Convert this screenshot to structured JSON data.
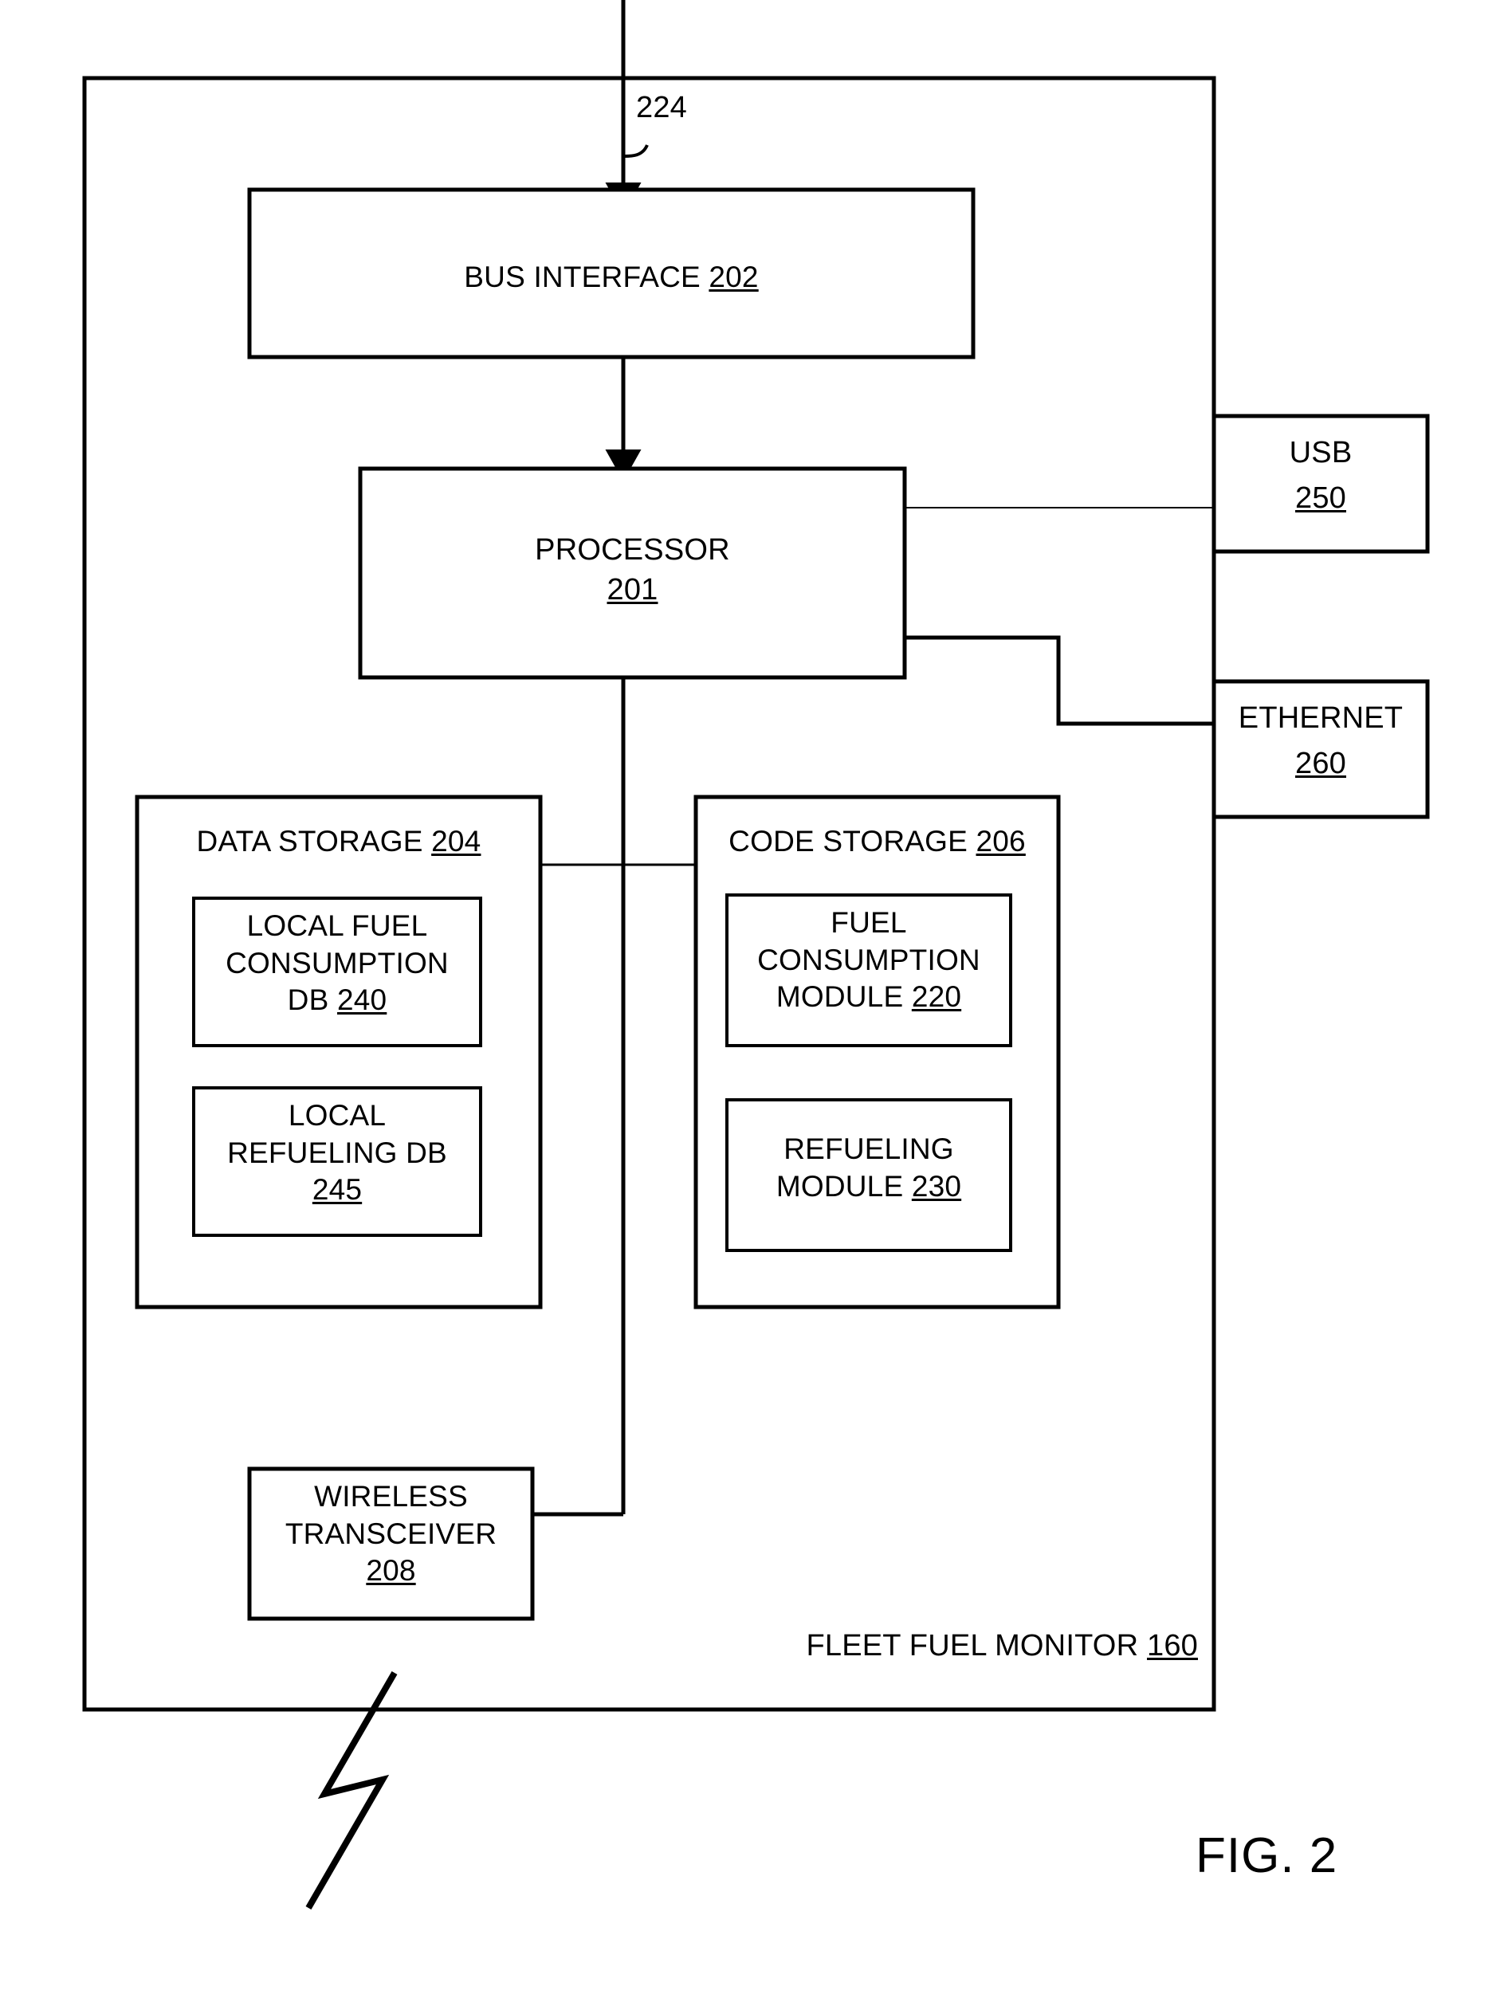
{
  "figure": {
    "caption": "FIG. 2",
    "outer_enclosure": {
      "name": "FLEET FUEL MONITOR",
      "ref": "160",
      "footer_text": "FLEET FUEL MONITOR 160"
    },
    "input_arrow_ref": "224"
  },
  "blocks": {
    "bus_interface": {
      "title": "BUS INTERFACE",
      "ref": "202"
    },
    "processor": {
      "title": "PROCESSOR",
      "ref": "201"
    },
    "data_storage": {
      "title": "DATA STORAGE",
      "ref": "204"
    },
    "code_storage": {
      "title": "CODE STORAGE",
      "ref": "206"
    },
    "local_fuel_consumption_db": {
      "line1": "LOCAL FUEL",
      "line2": "CONSUMPTION",
      "line3": "DB",
      "ref": "240"
    },
    "local_refueling_db": {
      "line1": "LOCAL",
      "line2": "REFUELING DB",
      "ref": "245"
    },
    "fuel_consumption_module": {
      "line1": "FUEL",
      "line2": "CONSUMPTION",
      "line3": "MODULE",
      "ref": "220"
    },
    "refueling_module": {
      "line1": "REFUELING",
      "line2": "MODULE",
      "ref": "230"
    },
    "wireless_transceiver": {
      "line1": "WIRELESS",
      "line2": "TRANSCEIVER",
      "ref": "208"
    },
    "usb": {
      "title": "USB",
      "ref": "250"
    },
    "ethernet": {
      "title": "ETHERNET",
      "ref": "260"
    }
  },
  "icons": {
    "break_symbol": "lightning-bolt-break-icon",
    "input_arrow": "down-arrow-icon",
    "bus_arrow": "down-arrow-icon",
    "leader_224": "curved-leader-line"
  },
  "colors": {
    "stroke": "#000000",
    "fill": "#ffffff",
    "text": "#000000"
  }
}
